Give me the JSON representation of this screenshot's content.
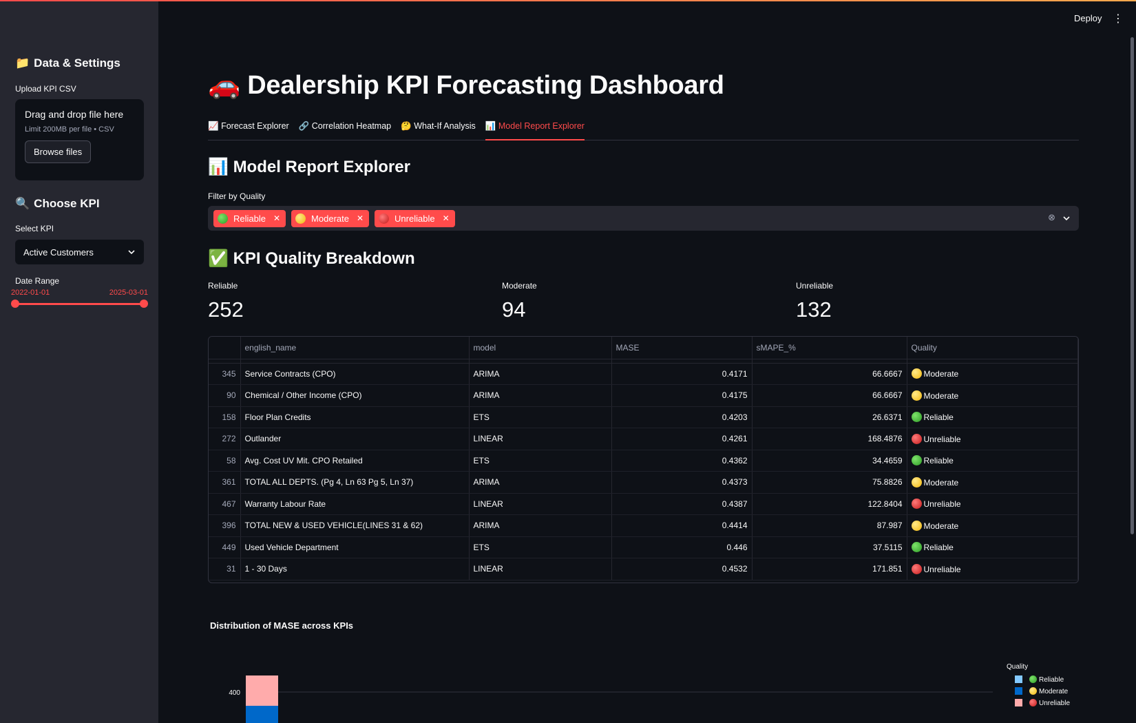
{
  "sidebar": {
    "data_title": "Data & Settings",
    "data_icon": "📁",
    "upload_label": "Upload KPI CSV",
    "drop_text": "Drag and drop file here",
    "limit_text": "Limit 200MB per file • CSV",
    "browse_label": "Browse files",
    "kpi_title": "Choose KPI",
    "kpi_icon": "🔍",
    "select_label": "Select KPI",
    "select_value": "Active Customers",
    "date_label": "Date Range",
    "date_start": "2022-01-01",
    "date_end": "2025-03-01"
  },
  "header": {
    "deploy": "Deploy"
  },
  "page": {
    "title": "Dealership KPI Forecasting Dashboard",
    "title_icon": "🚗",
    "tabs": [
      {
        "icon": "📈",
        "label": "Forecast Explorer"
      },
      {
        "icon": "🔗",
        "label": "Correlation Heatmap"
      },
      {
        "icon": "🤔",
        "label": "What-If Analysis"
      },
      {
        "icon": "📊",
        "label": "Model Report Explorer"
      }
    ],
    "active_tab": 3,
    "section_title": "Model Report Explorer",
    "section_icon": "📊",
    "filter_label": "Filter by Quality",
    "chips": [
      "Reliable",
      "Moderate",
      "Unreliable"
    ],
    "breakdown_title": "KPI Quality Breakdown",
    "breakdown_icon": "✅",
    "metrics": [
      {
        "label": "Reliable",
        "value": "252"
      },
      {
        "label": "Moderate",
        "value": "94"
      },
      {
        "label": "Unreliable",
        "value": "132"
      }
    ]
  },
  "table": {
    "columns": [
      "english_name",
      "model",
      "MASE",
      "sMAPE_%",
      "Quality"
    ],
    "rows": [
      {
        "idx": "345",
        "name": "Service Contracts (CPO)",
        "model": "ARIMA",
        "mase": "0.4171",
        "smape": "66.6667",
        "quality": "Moderate"
      },
      {
        "idx": "90",
        "name": "Chemical / Other Income (CPO)",
        "model": "ARIMA",
        "mase": "0.4175",
        "smape": "66.6667",
        "quality": "Moderate"
      },
      {
        "idx": "158",
        "name": "Floor Plan Credits",
        "model": "ETS",
        "mase": "0.4203",
        "smape": "26.6371",
        "quality": "Reliable"
      },
      {
        "idx": "272",
        "name": "Outlander",
        "model": "LINEAR",
        "mase": "0.4261",
        "smape": "168.4876",
        "quality": "Unreliable"
      },
      {
        "idx": "58",
        "name": "Avg. Cost UV Mit. CPO Retailed",
        "model": "ETS",
        "mase": "0.4362",
        "smape": "34.4659",
        "quality": "Reliable"
      },
      {
        "idx": "361",
        "name": "TOTAL ALL DEPTS. (Pg 4, Ln 63 Pg 5, Ln 37)",
        "model": "ARIMA",
        "mase": "0.4373",
        "smape": "75.8826",
        "quality": "Moderate"
      },
      {
        "idx": "467",
        "name": "Warranty Labour Rate",
        "model": "LINEAR",
        "mase": "0.4387",
        "smape": "122.8404",
        "quality": "Unreliable"
      },
      {
        "idx": "396",
        "name": "TOTAL NEW & USED VEHICLE(LINES 31 & 62)",
        "model": "ARIMA",
        "mase": "0.4414",
        "smape": "87.987",
        "quality": "Moderate"
      },
      {
        "idx": "449",
        "name": "Used Vehicle Department",
        "model": "ETS",
        "mase": "0.446",
        "smape": "37.5115",
        "quality": "Reliable"
      },
      {
        "idx": "31",
        "name": "1 - 30 Days",
        "model": "LINEAR",
        "mase": "0.4532",
        "smape": "171.851",
        "quality": "Unreliable"
      }
    ]
  },
  "chart_data": {
    "type": "bar",
    "title": "Distribution of MASE across KPIs",
    "y_tick_visible": "400",
    "series": [
      {
        "name": "Reliable",
        "color": "#83c9ff"
      },
      {
        "name": "Moderate",
        "color": "#0068c9"
      },
      {
        "name": "Unreliable",
        "color": "#ffabab"
      }
    ],
    "legend_title": "Quality",
    "legend_position": "right",
    "first_bar": {
      "Unreliable_top_estimate": 430,
      "Moderate_top_estimate": 375
    }
  },
  "colors": {
    "accent": "#ff4b4b",
    "background": "#0e1117",
    "sidebar": "#262730"
  }
}
